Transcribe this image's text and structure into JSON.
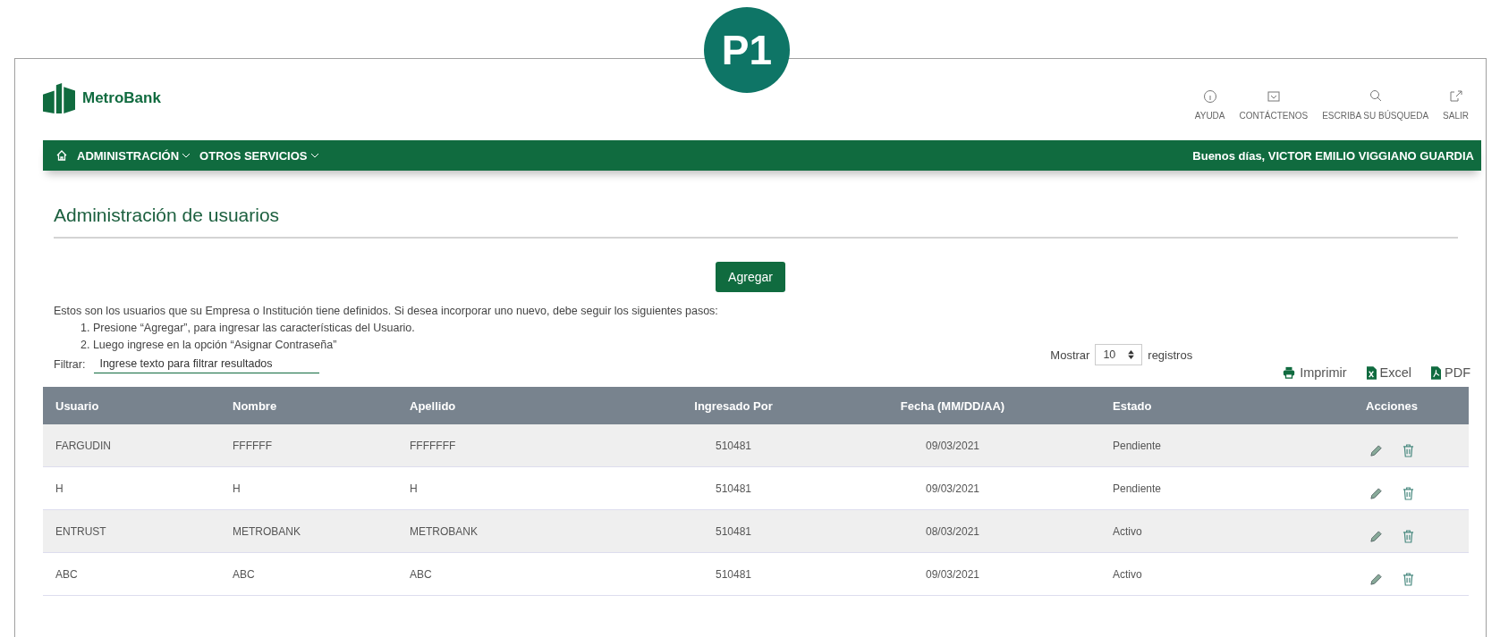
{
  "badge": "P1",
  "header": {
    "logo": "MetroBank",
    "links": [
      {
        "label": "AYUDA",
        "kind": "help"
      },
      {
        "label": "CONTÁCTENOS",
        "kind": "mail"
      },
      {
        "label": "ESCRIBA SU BÚSQUEDA",
        "kind": "search"
      },
      {
        "label": "SALIR",
        "kind": "exit"
      }
    ]
  },
  "nav": {
    "items": [
      "ADMINISTRACIÓN",
      "OTROS SERVICIOS"
    ],
    "greeting": "Buenos días, VICTOR EMILIO VIGGIANO GUARDIA"
  },
  "page_title": "Administración de usuarios",
  "add_button": "Agregar",
  "intro": "Estos son los usuarios que su Empresa o Institución tiene definidos. Si desea incorporar uno nuevo, debe seguir los siguientes pasos:",
  "steps": [
    "1. Presione “Agregar”, para ingresar las características del Usuario.",
    "2. Luego ingrese en la opción “Asignar Contraseña”"
  ],
  "filter": {
    "label": "Filtrar:",
    "placeholder": "Ingrese texto para filtrar resultados"
  },
  "page_size": {
    "before": "Mostrar",
    "value": "10",
    "after": "registros"
  },
  "exports": [
    {
      "label": "Imprimir",
      "kind": "print"
    },
    {
      "label": "Excel",
      "kind": "excel"
    },
    {
      "label": "PDF",
      "kind": "pdf"
    }
  ],
  "table": {
    "columns": [
      "Usuario",
      "Nombre",
      "Apellido",
      "Ingresado Por",
      "Fecha (MM/DD/AA)",
      "Estado",
      "Acciones"
    ],
    "rows": [
      [
        "FARGUDIN",
        "FFFFFF",
        "FFFFFFF",
        "510481",
        "09/03/2021",
        "Pendiente"
      ],
      [
        "H",
        "H",
        "H",
        "510481",
        "09/03/2021",
        "Pendiente"
      ],
      [
        "ENTRUST",
        "METROBANK",
        "METROBANK",
        "510481",
        "08/03/2021",
        "Activo"
      ],
      [
        "ABC",
        "ABC",
        "ABC",
        "510481",
        "09/03/2021",
        "Activo"
      ]
    ]
  }
}
